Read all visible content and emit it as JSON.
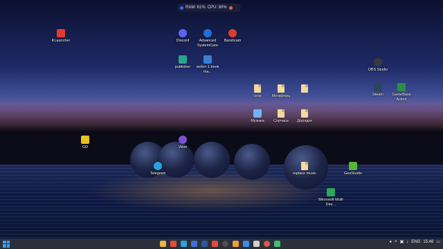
{
  "monitor": {
    "ram": "RAM: 61%",
    "cpu": "CPU: 80%"
  },
  "desktop_icons": [
    {
      "label": "KLauncher",
      "icon": "klauncher-icon",
      "color": "#e23b2e"
    },
    {
      "label": "Discord",
      "icon": "discord-icon",
      "color": "#5865f2"
    },
    {
      "label": "Advanced SystemCare",
      "icon": "systemcare-icon",
      "color": "#1f6fd8"
    },
    {
      "label": "Bandicam",
      "icon": "bandicam-icon",
      "color": "#d8402d"
    },
    {
      "label": "publisher",
      "icon": "publisher-icon",
      "color": "#2aa38f"
    },
    {
      "label": "иобот 1 book ma...",
      "icon": "book-icon",
      "color": "#3b7dd8"
    },
    {
      "label": "скор",
      "icon": "file-icon",
      "color": "#f1d9a0"
    },
    {
      "label": "Мегафорц",
      "icon": "file-icon",
      "color": "#f1d9a0"
    },
    {
      "label": "",
      "icon": "file-icon",
      "color": "#f1d9a0"
    },
    {
      "label": "Музыка",
      "icon": "folder-icon",
      "color": "#6fb3ff"
    },
    {
      "label": "Сорчаса",
      "icon": "file-icon",
      "color": "#f1d9a0"
    },
    {
      "label": "Дорядок",
      "icon": "file-icon",
      "color": "#f1d9a0"
    },
    {
      "label": "OBS Studio",
      "icon": "obs-icon",
      "color": "#3a3a3a"
    },
    {
      "label": "Steam",
      "icon": "steam-icon",
      "color": "#2a475e"
    },
    {
      "label": "GameBase Action",
      "icon": "game-icon",
      "color": "#2b8e4a"
    },
    {
      "label": "GD",
      "icon": "gd-icon",
      "color": "#e6c21b"
    },
    {
      "label": "Viber",
      "icon": "viber-icon",
      "color": "#7b51d3"
    },
    {
      "label": "Telegram",
      "icon": "telegram-icon",
      "color": "#2aa1e0"
    },
    {
      "label": "replace music",
      "icon": "file-icon",
      "color": "#f1d9a0"
    },
    {
      "label": "GeoStudio",
      "icon": "geostudio-icon",
      "color": "#58b53c"
    },
    {
      "label": "Microsoft Multi Dire...",
      "icon": "multi-icon",
      "color": "#2aa75a"
    }
  ],
  "taskbar": {
    "apps": [
      {
        "name": "file-explorer",
        "color": "#e8b74a"
      },
      {
        "name": "vivaldi",
        "color": "#e54b3d"
      },
      {
        "name": "telegram",
        "color": "#2aa1e0"
      },
      {
        "name": "ms-store",
        "color": "#3d6fd6"
      },
      {
        "name": "word",
        "color": "#2b579a"
      },
      {
        "name": "vivaldi-2",
        "color": "#e54b3d"
      },
      {
        "name": "obs",
        "color": "#505050"
      },
      {
        "name": "app-1",
        "color": "#e9a03b"
      },
      {
        "name": "app-2",
        "color": "#3b8ee9"
      },
      {
        "name": "app-3",
        "color": "#cfcfcf"
      },
      {
        "name": "app-4",
        "color": "#d9564a"
      },
      {
        "name": "app-5",
        "color": "#3fbf6e"
      }
    ],
    "tray": {
      "language": "ENG",
      "time": "15:48"
    }
  }
}
